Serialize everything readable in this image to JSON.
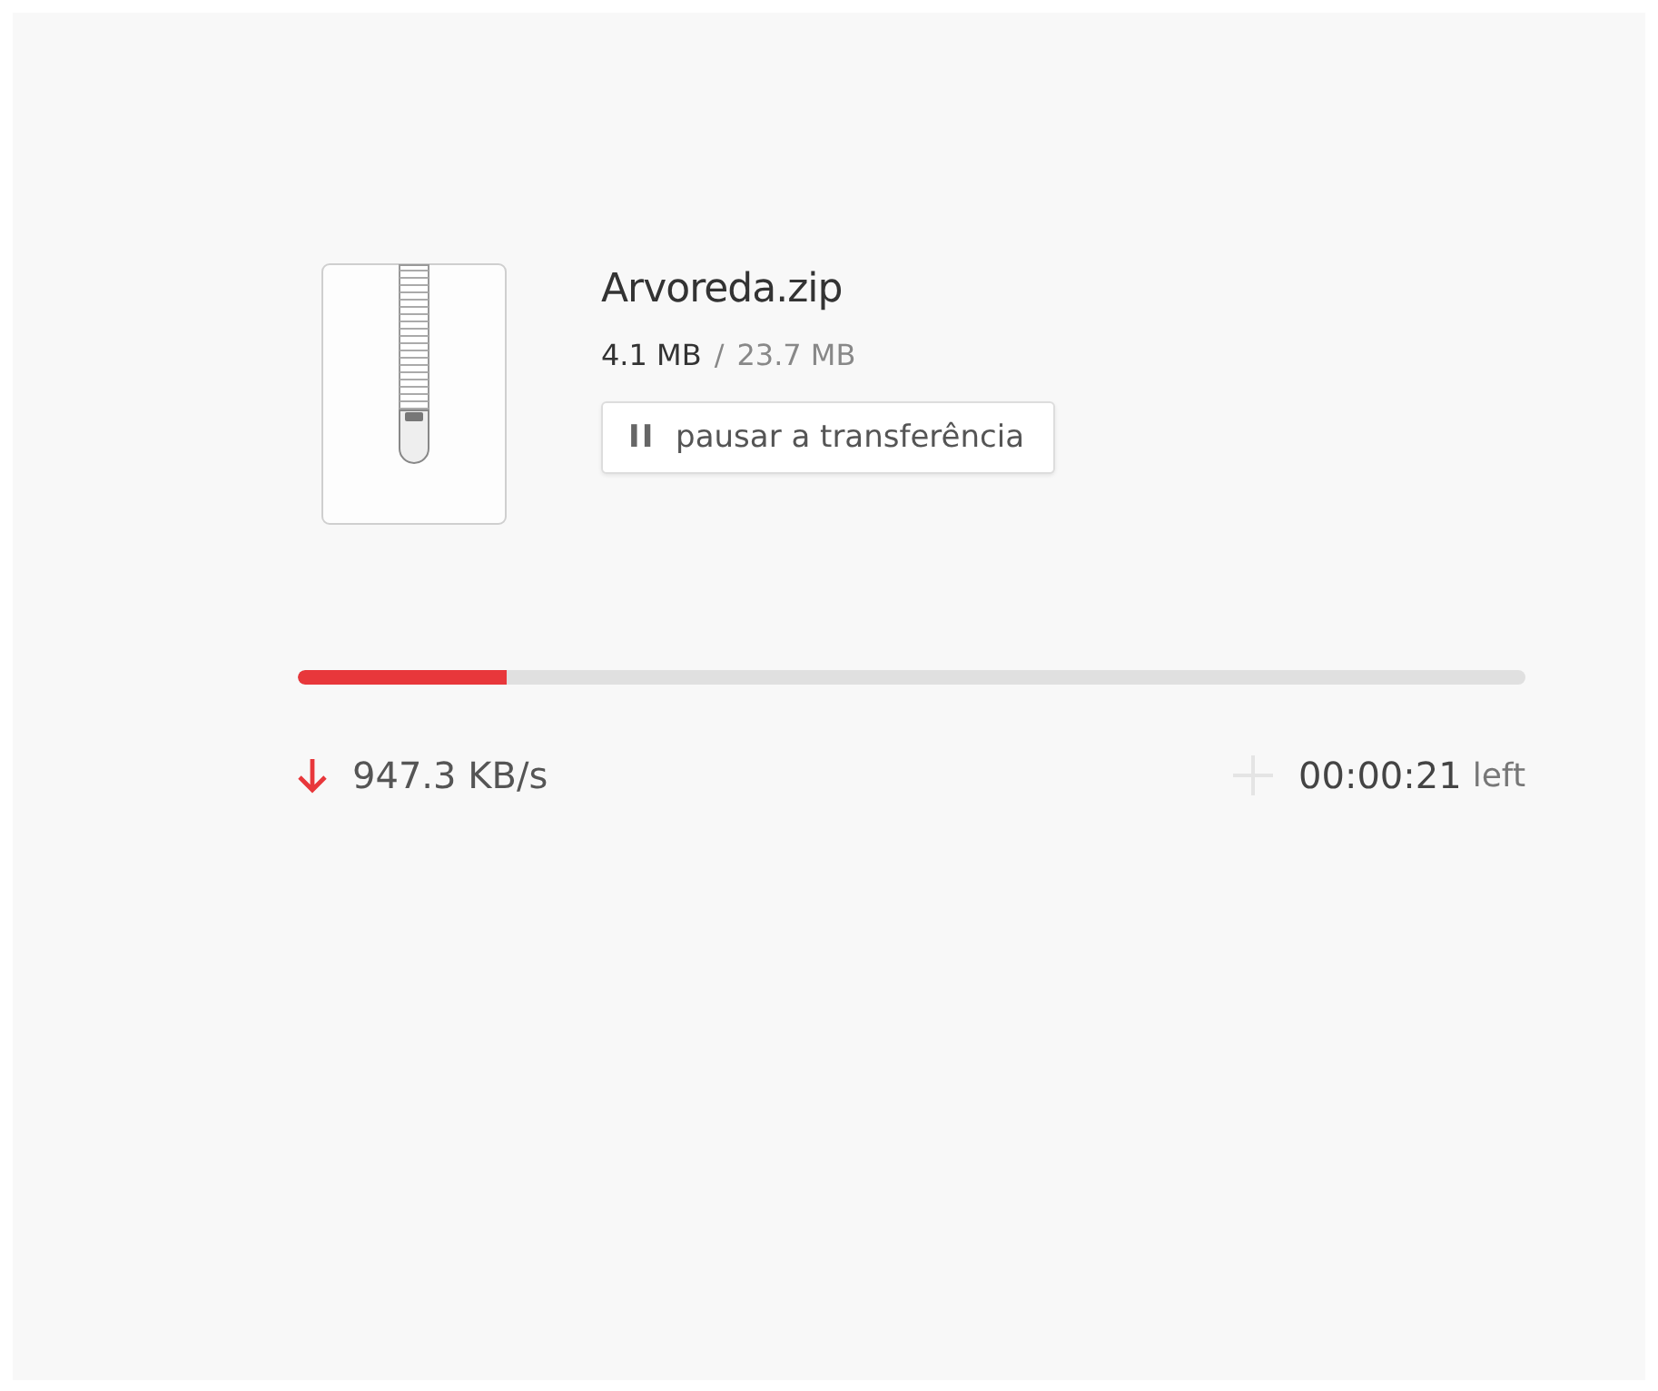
{
  "file": {
    "name": "Arvoreda.zip",
    "downloaded": "4.1 MB",
    "separator": "/",
    "total": "23.7 MB"
  },
  "pause_button": {
    "icon": "II",
    "label": "pausar a transferência"
  },
  "progress": {
    "level": 0.17
  },
  "speed": "947.3 KB/s",
  "remaining": {
    "time": "00:00:21",
    "suffix": "left"
  }
}
